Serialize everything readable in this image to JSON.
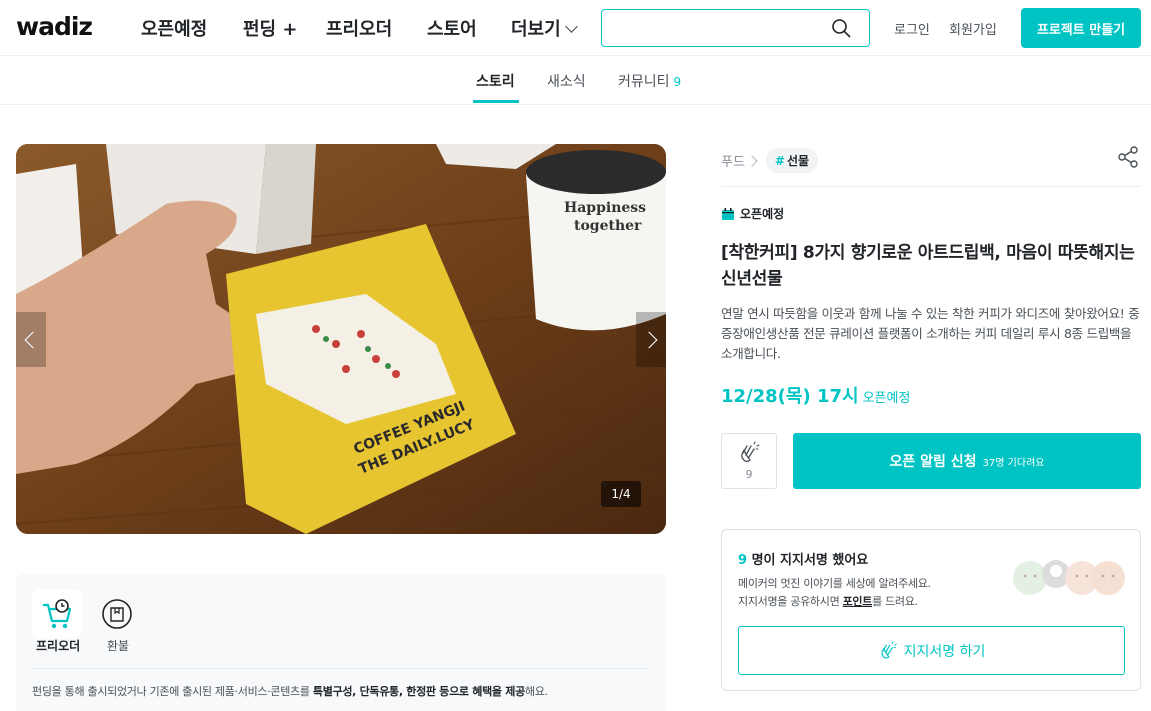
{
  "header": {
    "logo": "wadiz",
    "nav": [
      "오픈예정",
      "펀딩 +",
      "프리오더",
      "스토어",
      "더보기"
    ],
    "search_placeholder": "",
    "login": "로그인",
    "signup": "회원가입",
    "cta": "프로젝트 만들기"
  },
  "tabs": {
    "story": "스토리",
    "news": "새소식",
    "community": "커뮤니티",
    "community_count": "9"
  },
  "hero": {
    "pager": "1/4"
  },
  "infobox": {
    "preorder_label": "프리오더",
    "refund_label": "환불",
    "desc_prefix": "펀딩을 통해 출시되었거나 기존에 출시된 제품·서비스·콘텐츠를 ",
    "desc_bold": "특별구성, 단독유통, 한정판 등으로 혜택을 제공",
    "desc_suffix": "해요."
  },
  "project": {
    "category": "푸드",
    "tag": "선물",
    "status": "오픈예정",
    "title": "[착한커피] 8가지 향기로운 아트드립백, 마음이 따뜻해지는 신년선물",
    "description": "연말 연시 따듯함을 이웃과 함께 나눌 수 있는 착한 커피가 와디즈에 찾아왔어요! 중증장애인생산품 전문 큐레이션 플랫폼이 소개하는 커피 데일리 루시 8종 드립백을 소개합니다.",
    "open_date": "12/28(목) 17시",
    "open_label": "오픈예정",
    "like_count": "9",
    "notify_label": "오픈 알림 신청",
    "notify_sub": "37명 기다려요"
  },
  "support": {
    "count": "9",
    "title_suffix": " 명이 지지서명 했어요",
    "line1": "메이커의 멋진 이야기를 세상에 알려주세요.",
    "line2_prefix": "지지서명을 공유하시면 ",
    "line2_bold": "포인트",
    "line2_suffix": "를 드려요.",
    "button": "지지서명 하기"
  },
  "colors": {
    "accent": "#00c4c4"
  }
}
